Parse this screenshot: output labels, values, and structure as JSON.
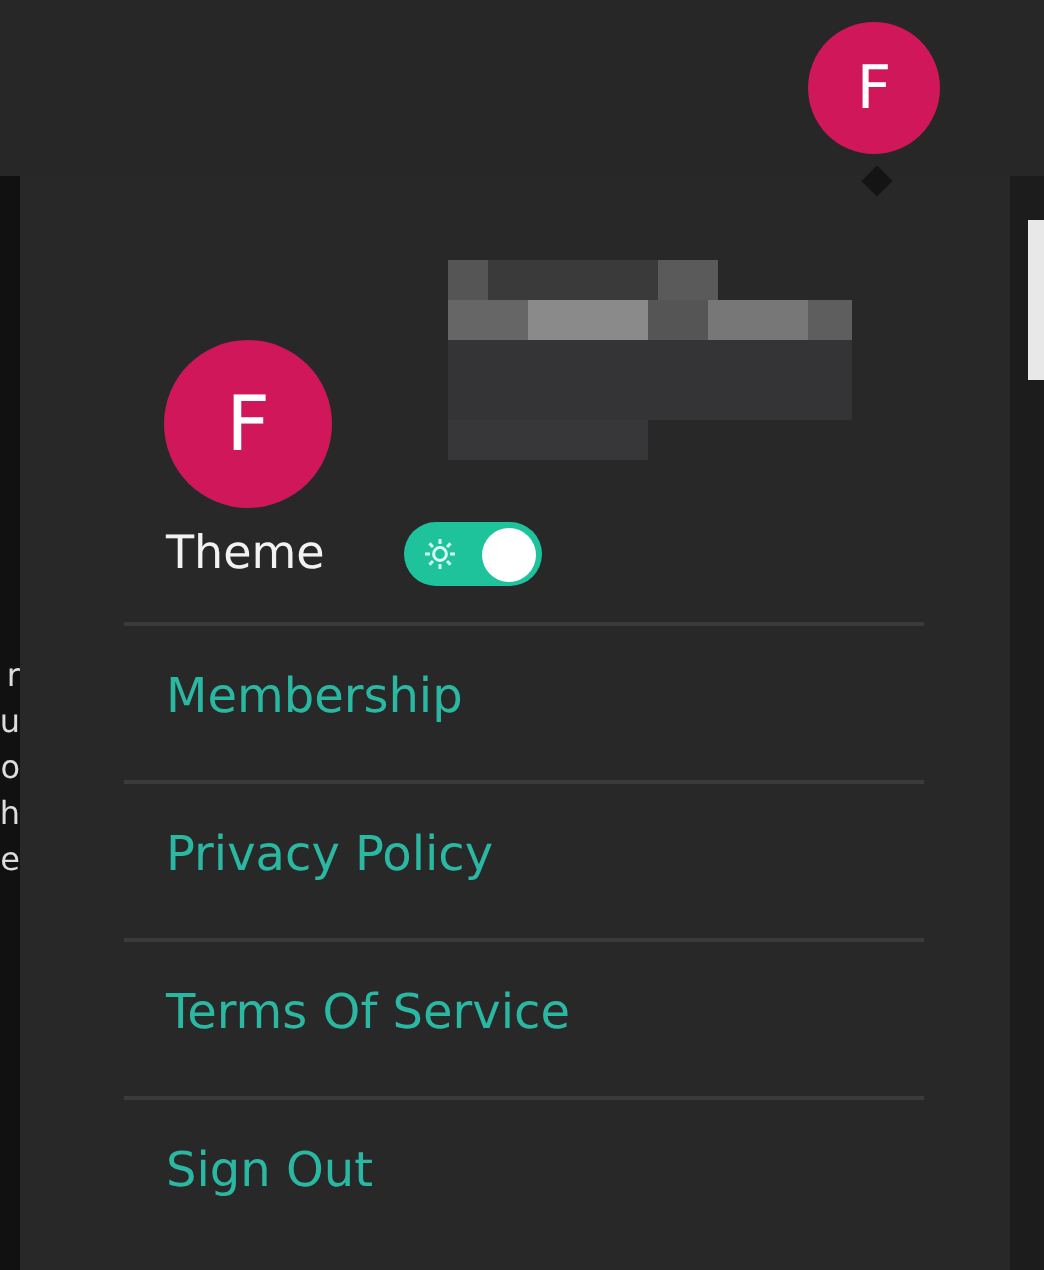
{
  "header": {
    "avatar_initial": "F"
  },
  "edge_fragments": [
    "r",
    "u",
    "o",
    "h",
    "e"
  ],
  "menu": {
    "avatar_initial": "F",
    "theme": {
      "label": "Theme",
      "on": true
    },
    "items": [
      {
        "label": "Membership"
      },
      {
        "label": "Privacy Policy"
      },
      {
        "label": "Terms Of Service"
      },
      {
        "label": "Sign Out"
      }
    ]
  }
}
